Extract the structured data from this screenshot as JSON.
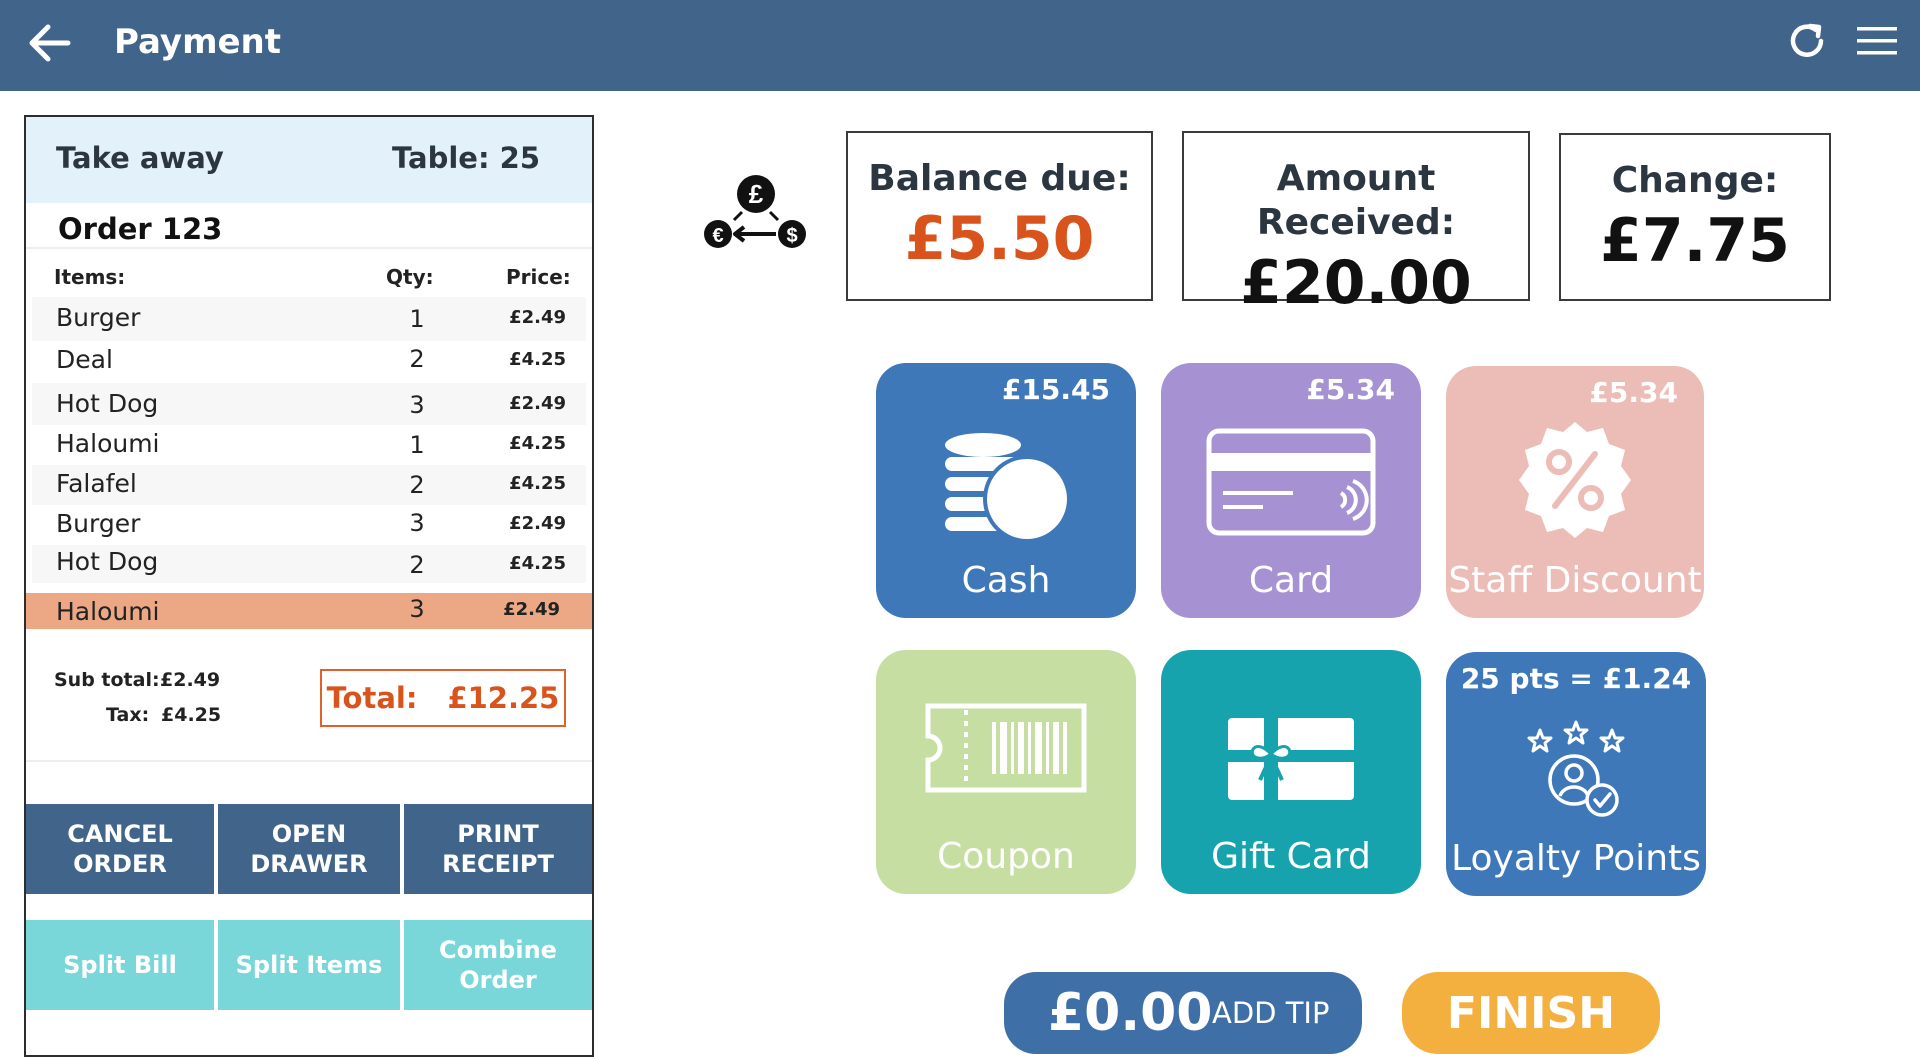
{
  "header": {
    "title": "Payment",
    "back_icon": "arrow-left-icon",
    "refresh_icon": "refresh-icon",
    "menu_icon": "hamburger-menu-icon",
    "bg_color": "#41648a"
  },
  "order": {
    "type": "Take away",
    "table": "Table: 25",
    "number": "Order 123",
    "columns": {
      "items": "Items:",
      "qty": "Qty:",
      "price": "Price:"
    },
    "items": [
      {
        "name": "Burger",
        "qty": "1",
        "price": "£2.49"
      },
      {
        "name": "Deal",
        "qty": "2",
        "price": "£4.25"
      },
      {
        "name": "Hot Dog",
        "qty": "3",
        "price": "£2.49"
      },
      {
        "name": "Haloumi",
        "qty": "1",
        "price": "£4.25"
      },
      {
        "name": "Falafel",
        "qty": "2",
        "price": "£4.25"
      },
      {
        "name": "Burger",
        "qty": "3",
        "price": "£2.49"
      },
      {
        "name": "Hot Dog",
        "qty": "2",
        "price": "£4.25"
      },
      {
        "name": "Haloumi",
        "qty": "3",
        "price": "£2.49"
      }
    ],
    "selected_index": 7,
    "subtotal_label": "Sub total:",
    "subtotal_value": "£2.49",
    "tax_label": "Tax:",
    "tax_value": "£4.25",
    "total_label": "Total:",
    "total_value": "£12.25"
  },
  "actions": {
    "cancel_order": "CANCEL\nORDER",
    "open_drawer": "OPEN\nDRAWER",
    "print_receipt": "PRINT\nRECEIPT",
    "split_bill": "Split Bill",
    "split_items": "Split Items",
    "combine_order": "Combine\nOrder"
  },
  "summary": {
    "icon": "currency-exchange-icon",
    "balance_label": "Balance due:",
    "balance_value": "£5.50",
    "received_label": "Amount Received:",
    "received_value": "£20.00",
    "change_label": "Change:",
    "change_value": "£7.75",
    "balance_color": "#d9531c"
  },
  "payment_methods": {
    "cash": {
      "label": "Cash",
      "amount": "£15.45",
      "icon": "coins-icon",
      "color": "#3e78b8"
    },
    "card": {
      "label": "Card",
      "amount": "£5.34",
      "icon": "credit-card-contactless-icon",
      "color": "#a692d3"
    },
    "staff_discount": {
      "label": "Staff Discount",
      "amount": "£5.34",
      "icon": "discount-badge-icon",
      "color": "#ecbcb6"
    },
    "coupon": {
      "label": "Coupon",
      "icon": "barcode-ticket-icon",
      "color": "#c6dea2"
    },
    "gift_card": {
      "label": "Gift Card",
      "icon": "gift-card-icon",
      "color": "#16a3ad"
    },
    "loyalty": {
      "label": "Loyalty Points",
      "amount": "25 pts = £1.24",
      "icon": "loyalty-user-stars-icon",
      "color": "#3e78b8"
    }
  },
  "tip": {
    "amount": "£0.00",
    "label": "ADD TIP"
  },
  "finish": {
    "label": "FINISH"
  }
}
